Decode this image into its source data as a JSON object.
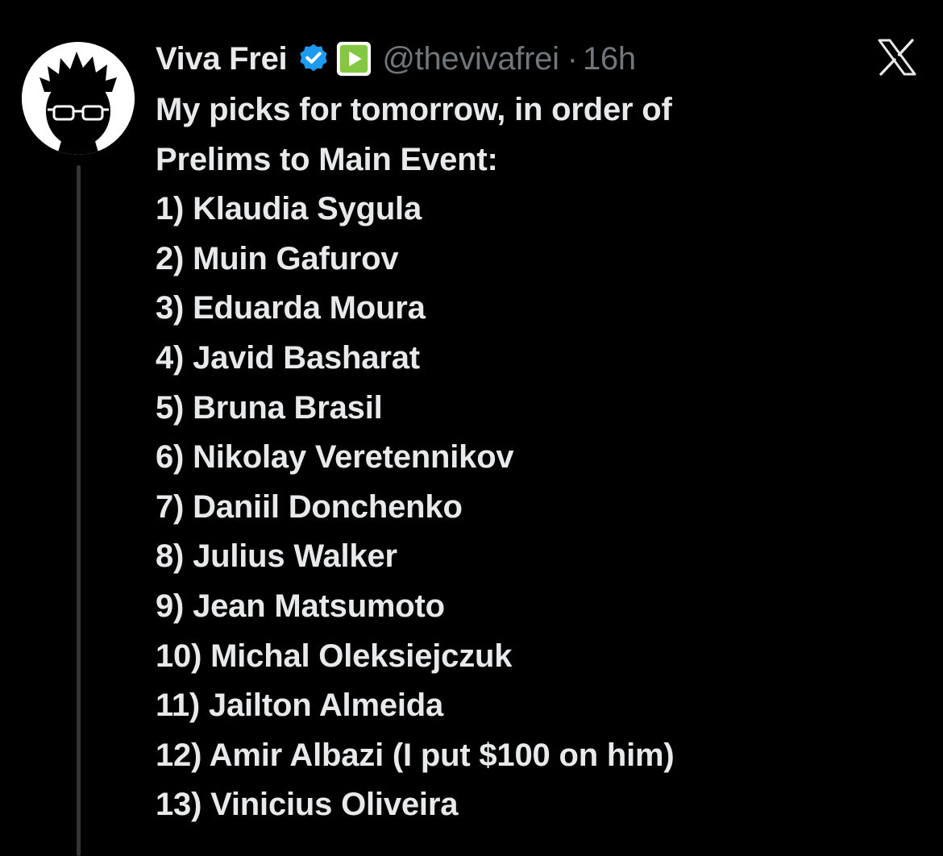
{
  "tweet": {
    "display_name": "Viva Frei",
    "handle": "@thevivafrei",
    "separator": "·",
    "time": "16h",
    "intro_lines": [
      "My picks for tomorrow, in order of",
      "Prelims to Main Event:"
    ],
    "picks": [
      "1) Klaudia Sygula",
      "2) Muin Gafurov",
      "3) Eduarda Moura",
      "4) Javid Basharat",
      "5) Bruna Brasil",
      "6) Nikolay Veretennikov",
      "7) Daniil Donchenko",
      "8) Julius Walker",
      "9) Jean Matsumoto",
      "10) Michal Oleksiejczuk",
      "11) Jailton Almeida",
      "12) Amir Albazi (I put $100 on him)",
      "13) Vinicius Oliveira"
    ]
  },
  "icons": {
    "avatar": "avatar-icon",
    "verified": "verified-badge-icon",
    "affiliate": "rumble-affiliate-icon",
    "brand": "x-logo-icon"
  },
  "colors": {
    "background": "#000000",
    "text_primary": "#e7e9ea",
    "text_secondary": "#71767b",
    "verified_blue": "#1d9bf0",
    "affiliate_green": "#85c742",
    "thread_line": "#333639"
  }
}
